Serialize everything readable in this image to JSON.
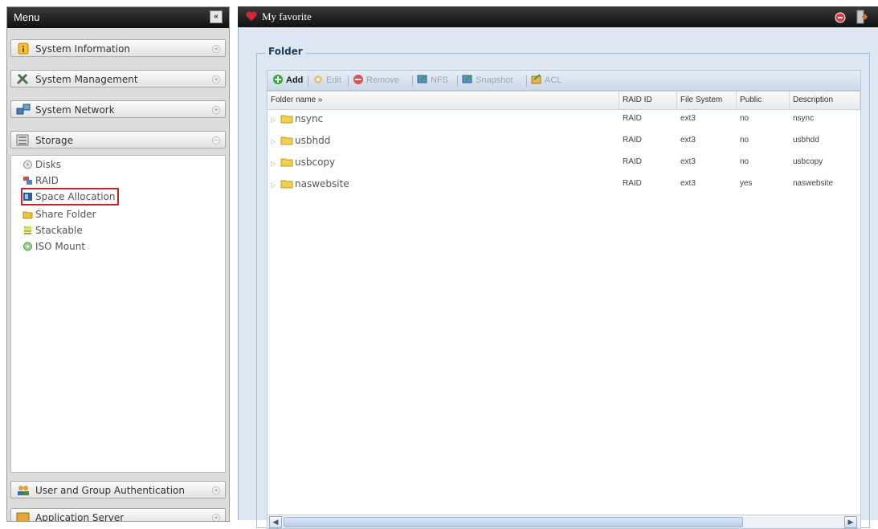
{
  "menu": {
    "title": "Menu",
    "collapse_glyph": "«",
    "sections": [
      {
        "label": "System Information",
        "icon": "info-icon"
      },
      {
        "label": "System Management",
        "icon": "tools-icon"
      },
      {
        "label": "System Network",
        "icon": "network-icon"
      },
      {
        "label": "Storage",
        "icon": "storage-icon"
      },
      {
        "label": "User and Group Authentication",
        "icon": "users-icon"
      },
      {
        "label": "Application Server",
        "icon": "app-server-icon"
      }
    ],
    "storage_items": [
      {
        "label": "Disks",
        "icon": "disk-icon"
      },
      {
        "label": "RAID",
        "icon": "raid-icon"
      },
      {
        "label": "Space Allocation",
        "icon": "space-allocation-icon",
        "highlighted": true
      },
      {
        "label": "Share Folder",
        "icon": "share-folder-icon"
      },
      {
        "label": "Stackable",
        "icon": "stackable-icon"
      },
      {
        "label": "ISO Mount",
        "icon": "iso-mount-icon"
      }
    ]
  },
  "topbar": {
    "favorite_label": "My favorite"
  },
  "folder": {
    "legend": "Folder",
    "toolbar": {
      "add": "Add",
      "edit": "Edit",
      "remove": "Remove",
      "nfs": "NFS",
      "snapshot": "Snapshot",
      "acl": "ACL"
    },
    "columns": [
      "Folder name »",
      "RAID ID",
      "File System",
      "Public",
      "Description"
    ],
    "rows": [
      {
        "name": "nsync",
        "raid_id": "RAID",
        "fs": "ext3",
        "public": "no",
        "description": "nsync"
      },
      {
        "name": "usbhdd",
        "raid_id": "RAID",
        "fs": "ext3",
        "public": "no",
        "description": "usbhdd"
      },
      {
        "name": "usbcopy",
        "raid_id": "RAID",
        "fs": "ext3",
        "public": "no",
        "description": "usbcopy"
      },
      {
        "name": "naswebsite",
        "raid_id": "RAID",
        "fs": "ext3",
        "public": "yes",
        "description": "naswebsite"
      }
    ]
  },
  "colors": {
    "highlight": "#c8232c",
    "header_bar": "#1a1a1a",
    "main_bg": "#dce7f2"
  }
}
